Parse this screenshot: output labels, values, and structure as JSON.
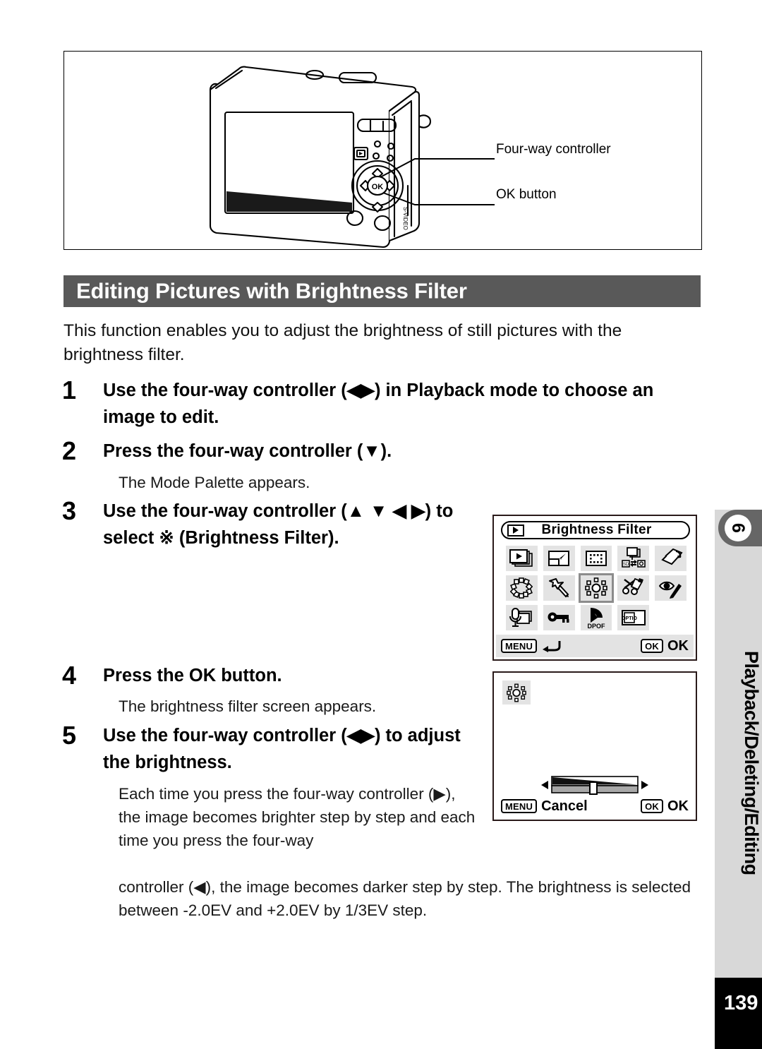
{
  "figure": {
    "callouts": [
      {
        "id": "four-way-controller",
        "label": "Four-way controller"
      },
      {
        "id": "ok-button",
        "label": "OK button"
      }
    ],
    "camera_illustration": "camera-rear-view-illustration"
  },
  "section": {
    "title": "Editing Pictures with Brightness Filter",
    "intro": "This function enables you to adjust the brightness of still pictures with the brightness filter."
  },
  "steps": [
    {
      "number": "1",
      "text": "Use the four-way controller (◀▶)  in Playback mode to choose an image to edit."
    },
    {
      "number": "2",
      "text": "Press the four-way controller (▼).",
      "note": "The Mode Palette appears."
    },
    {
      "number": "3",
      "text": "Use the four-way controller (▲ ▼ ◀ ▶) to select ※ (Brightness Filter)."
    },
    {
      "number": "4",
      "text": "Press the OK button.",
      "note": "The brightness filter screen appears."
    },
    {
      "number": "5",
      "text": "Use the four-way controller (◀▶) to adjust the brightness.",
      "body_narrow": "Each time you press the four-way controller (▶), the image becomes brighter step by step and each time you press the four-way",
      "body_wide": "controller (◀), the image becomes darker step by step. The brightness is selected between -2.0EV and +2.0EV by 1/3EV step."
    }
  ],
  "lcd_mode_palette": {
    "title": "Brightness Filter",
    "title_icon": "playback-mode-icon",
    "grid": [
      {
        "icon": "slideshow-icon",
        "selected": false
      },
      {
        "icon": "resize-icon",
        "selected": false
      },
      {
        "icon": "cropping-icon",
        "selected": false
      },
      {
        "icon": "image-copy-icon",
        "selected": false
      },
      {
        "icon": "image-rotation-icon",
        "selected": false
      },
      {
        "icon": "digital-filter-icon",
        "selected": false
      },
      {
        "icon": "frame-composite-icon",
        "selected": false
      },
      {
        "icon": "brightness-filter-icon",
        "selected": true
      },
      {
        "icon": "movie-edit-icon",
        "selected": false
      },
      {
        "icon": "red-eye-compensation-icon",
        "selected": false
      },
      {
        "icon": "voice-memo-icon",
        "selected": false
      },
      {
        "icon": "protect-key-icon",
        "selected": false
      },
      {
        "icon": "dpof-icon",
        "selected": false
      },
      {
        "icon": "start-up-screen-icon",
        "selected": false
      },
      {
        "icon": "empty-cell",
        "selected": false
      }
    ],
    "bottom_bar": {
      "menu_key": "MENU",
      "menu_label": "back-arrow-icon",
      "ok_key": "OK",
      "ok_label": "OK"
    }
  },
  "lcd_brightness_screen": {
    "icon": "brightness-filter-icon",
    "slider": "brightness-gradient-slider",
    "left_arrow": "left-triangle-icon",
    "right_arrow": "right-triangle-icon",
    "bottom_bar": {
      "menu_key": "MENU",
      "menu_label": "Cancel",
      "ok_key": "OK",
      "ok_label": "OK"
    }
  },
  "side_tab": {
    "chapter_number": "6",
    "label": "Playback/Deleting/Editing"
  },
  "page": {
    "number": "139"
  },
  "colors": {
    "title_bar": "#595959",
    "side_tab_bg": "#d8d8d8",
    "side_tab_head": "#666666",
    "page_block": "#000000",
    "palette_cell": "#e3e3e3",
    "selection_border": "#8c8c8c"
  }
}
